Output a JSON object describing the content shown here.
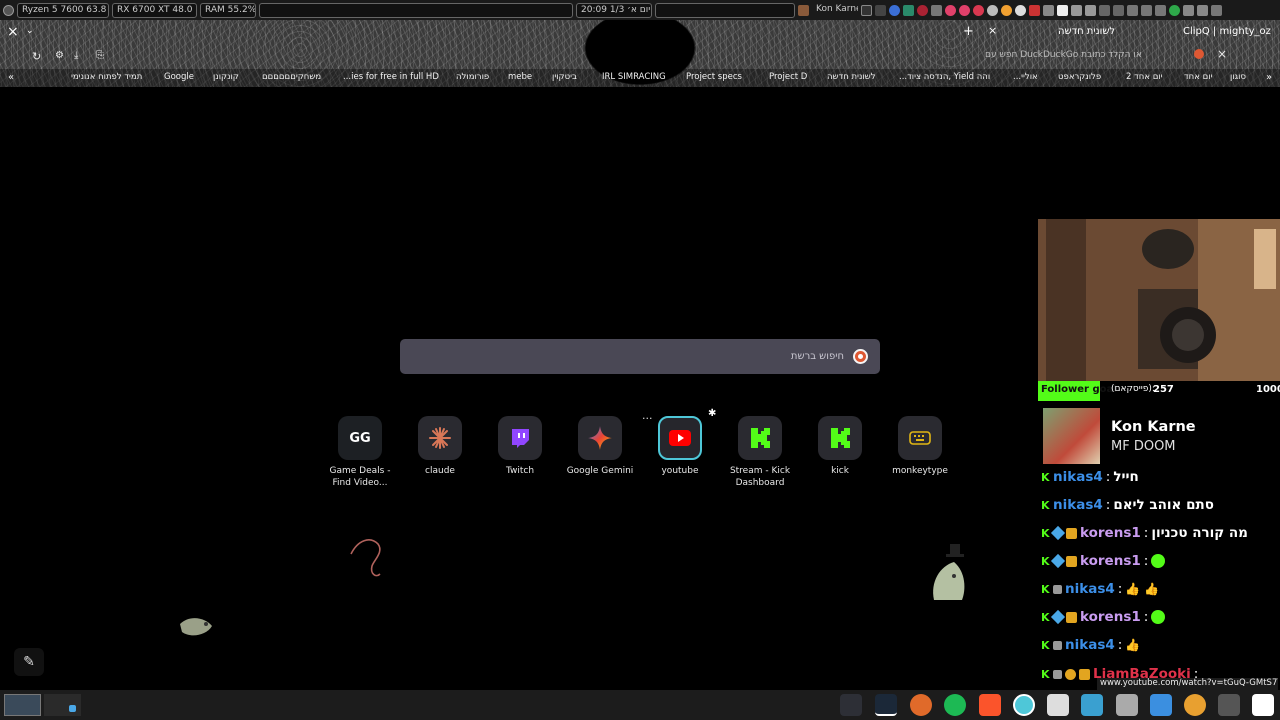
{
  "system_panel": {
    "cpu": "Ryzen 5 7600 63.8 °C",
    "gpu": "RX 6700 XT 48.0 °C",
    "ram": "RAM   55.2%",
    "clock": "20:09 יום א׳ 1/3",
    "now_playing": "Kon Karne"
  },
  "browser": {
    "active_tab": "לשונית חדשה",
    "other_tab": "ClipQ | mighty_oz",
    "close_tab": "×",
    "new_tab": "+",
    "url_placeholder": "חפש עם DuckDuckGo או הקלד כתובת",
    "bookmarks": [
      "תמיד לפתוח אנונימי",
      "Google",
      "קונקונן",
      "משחקיםםםםםם",
      "...ies for free in full HD",
      "פורומולה",
      "mebe",
      "ביטקוין",
      "IRL SIMRACING",
      "Project specs",
      "Project D",
      "לשונית חדשה",
      "...הנדסה ציוד, Yield והה",
      "...אוליי",
      "פלונקראפט",
      "יום אחד 2",
      "יום אחד",
      "סוגון"
    ]
  },
  "newtab": {
    "search_placeholder": "חיפוש ברשת",
    "tiles": [
      {
        "label": "Game Deals - Find Video...",
        "icon": "gg-icon",
        "color": "#1d2024"
      },
      {
        "label": "claude",
        "icon": "claude-icon",
        "color": "#d97757"
      },
      {
        "label": "Twitch",
        "icon": "twitch-icon",
        "color": "#9146ff"
      },
      {
        "label": "Google Gemini",
        "icon": "gemini-icon",
        "color": "#4285f4"
      },
      {
        "label": "youtube",
        "icon": "youtube-icon",
        "color": "#ff0000"
      },
      {
        "label": "Stream - Kick Dashboard",
        "icon": "kick-icon",
        "color": "#53fc18"
      },
      {
        "label": "kick",
        "icon": "kick-icon",
        "color": "#53fc18"
      },
      {
        "label": "monkeytype",
        "icon": "keyboard-icon",
        "color": "#e2b714"
      }
    ]
  },
  "overlay": {
    "goal_label": "Follower goal",
    "goal_suffix": "(פייסקאם):",
    "goal_current": "257",
    "goal_target": "1000",
    "goal_fraction": 0.257,
    "song_title": "Kon Karne",
    "song_artist": "MF DOOM",
    "chat": [
      {
        "user": "nikas4",
        "color": "#3c8fe8",
        "text": "חייל"
      },
      {
        "user": "nikas4",
        "color": "#3c8fe8",
        "text": "סתם אוהב ליאם"
      },
      {
        "user": "korens1",
        "color": "#c99cf0",
        "text": "מה קורה טכניון"
      },
      {
        "user": "korens1",
        "color": "#c99cf0",
        "text": ""
      },
      {
        "user": "nikas4",
        "color": "#3c8fe8",
        "text": ""
      },
      {
        "user": "korens1",
        "color": "#c99cf0",
        "text": ""
      },
      {
        "user": "nikas4",
        "color": "#3c8fe8",
        "text": ""
      },
      {
        "user": "LiamBaZooki",
        "color": "#e0324a",
        "text": ""
      }
    ]
  },
  "status_url": "www.youtube.com/watch?v=tGuQ-GMtS7Y"
}
